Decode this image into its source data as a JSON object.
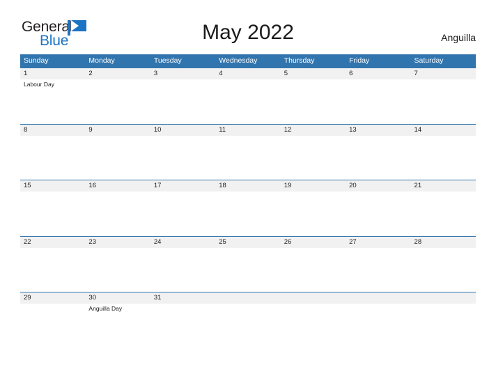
{
  "brand": {
    "name_part1": "General",
    "name_part2": "Blue",
    "flag_icon": "blue-flag-icon",
    "color_dark": "#231f20",
    "color_blue": "#1b73c4"
  },
  "header": {
    "title": "May 2022",
    "region": "Anguilla"
  },
  "theme": {
    "header_blue": "#3175ae",
    "date_strip_gray": "#f1f1f1",
    "page_background": "#ffffff",
    "text": "#1a1a1a"
  },
  "calendar": {
    "weekdays": [
      "Sunday",
      "Monday",
      "Tuesday",
      "Wednesday",
      "Thursday",
      "Friday",
      "Saturday"
    ],
    "weeks": [
      [
        {
          "day": "1",
          "events": [
            "Labour Day"
          ]
        },
        {
          "day": "2",
          "events": []
        },
        {
          "day": "3",
          "events": []
        },
        {
          "day": "4",
          "events": []
        },
        {
          "day": "5",
          "events": []
        },
        {
          "day": "6",
          "events": []
        },
        {
          "day": "7",
          "events": []
        }
      ],
      [
        {
          "day": "8",
          "events": []
        },
        {
          "day": "9",
          "events": []
        },
        {
          "day": "10",
          "events": []
        },
        {
          "day": "11",
          "events": []
        },
        {
          "day": "12",
          "events": []
        },
        {
          "day": "13",
          "events": []
        },
        {
          "day": "14",
          "events": []
        }
      ],
      [
        {
          "day": "15",
          "events": []
        },
        {
          "day": "16",
          "events": []
        },
        {
          "day": "17",
          "events": []
        },
        {
          "day": "18",
          "events": []
        },
        {
          "day": "19",
          "events": []
        },
        {
          "day": "20",
          "events": []
        },
        {
          "day": "21",
          "events": []
        }
      ],
      [
        {
          "day": "22",
          "events": []
        },
        {
          "day": "23",
          "events": []
        },
        {
          "day": "24",
          "events": []
        },
        {
          "day": "25",
          "events": []
        },
        {
          "day": "26",
          "events": []
        },
        {
          "day": "27",
          "events": []
        },
        {
          "day": "28",
          "events": []
        }
      ],
      [
        {
          "day": "29",
          "events": []
        },
        {
          "day": "30",
          "events": [
            "Anguilla Day"
          ]
        },
        {
          "day": "31",
          "events": []
        },
        {
          "day": "",
          "events": []
        },
        {
          "day": "",
          "events": []
        },
        {
          "day": "",
          "events": []
        },
        {
          "day": "",
          "events": []
        }
      ]
    ]
  }
}
